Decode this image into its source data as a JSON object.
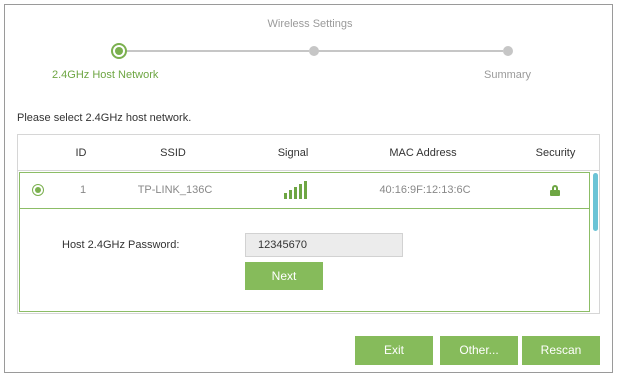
{
  "wizard": {
    "title": "Wireless Settings",
    "steps": [
      {
        "label": "2.4GHz Host Network",
        "state": "active"
      },
      {
        "label": "",
        "state": "pending"
      },
      {
        "label": "Summary",
        "state": "pending"
      }
    ]
  },
  "prompt": "Please select 2.4GHz host network.",
  "table": {
    "columns": [
      "ID",
      "SSID",
      "Signal",
      "MAC Address",
      "Security"
    ],
    "rows": [
      {
        "selected": true,
        "id": "1",
        "ssid": "TP-LINK_136C",
        "signal_bars": 5,
        "signal_icon": "signal-bars-icon",
        "mac": "40:16:9F:12:13:6C",
        "security_icon": "lock-icon"
      }
    ]
  },
  "password": {
    "label": "Host 2.4GHz Password:",
    "value": "12345670"
  },
  "buttons": {
    "next": "Next",
    "exit": "Exit",
    "other": "Other...",
    "rescan": "Rescan"
  },
  "colors": {
    "accent": "#86bb5b",
    "accent_dark": "#6ea643",
    "scrollbar": "#6bc3d6",
    "inactive": "#c6c6c6"
  }
}
